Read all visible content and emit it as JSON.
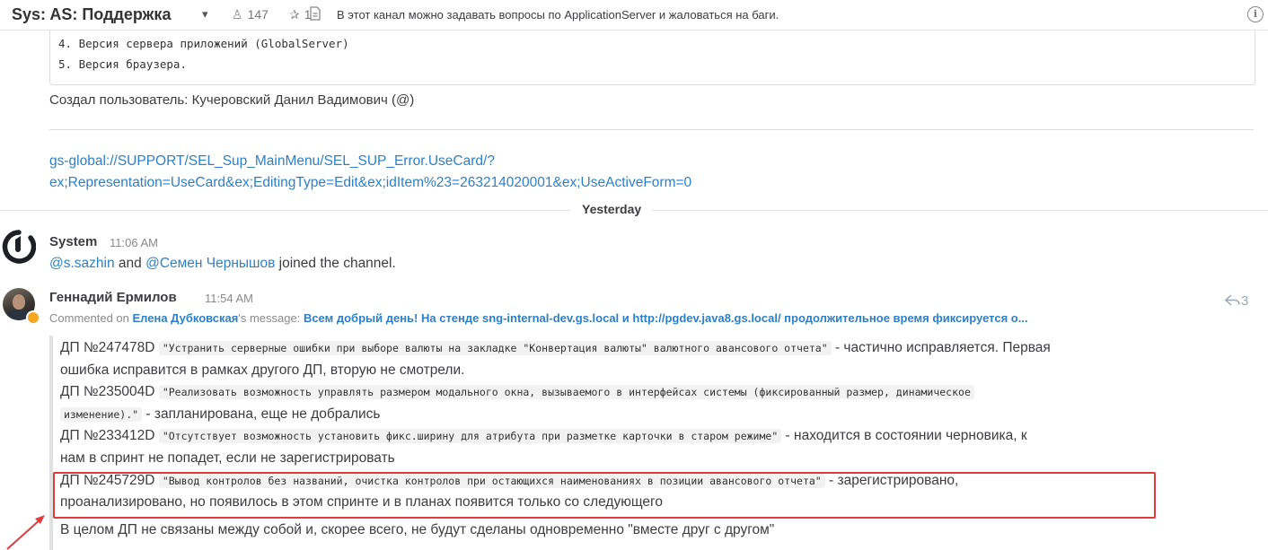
{
  "header": {
    "channel_name": "Sys: AS: Поддержка",
    "member_count": "147",
    "pinned_count": "1",
    "purpose": "В этот канал можно задавать вопросы по ApplicationServer и жаловаться на баги.",
    "info_icon_glyph": "i"
  },
  "earlier_post": {
    "code_lines": [
      "4. Версия сервера приложений (GlobalServer)",
      "5. Версия браузера."
    ],
    "created_by": "Создал пользователь: Кучеровский Данил Вадимович (@)",
    "link_line1": "gs-global://SUPPORT/SEL_Sup_MainMenu/SEL_SUP_Error.UseCard/?",
    "link_line2": "ex;Representation=UseCard&ex;EditingType=Edit&ex;idItem%23=263214020001&ex;UseActiveForm=0"
  },
  "date_separator": "Yesterday",
  "system_post": {
    "author": "System",
    "time": "11:06 AM",
    "mention1": "@s.sazhin",
    "and": " and ",
    "mention2": "@Семен Чернышов",
    "rest": " joined the channel."
  },
  "reply_post": {
    "author": "Геннадий Ермилов",
    "time": "11:54 AM",
    "reply_count": "3",
    "commented_prefix": "Commented on ",
    "commented_user": "Елена Дубковская",
    "commented_mid": "'s message: ",
    "commented_message": "Всем добрый день! На стенде sng-internal-dev.gs.local и http://pgdev.java8.gs.local/ продолжительное время фиксируется о...",
    "items": [
      {
        "id": "ДП №247478D",
        "code": "\"Устранить серверные ошибки при выборе валюты на закладке \"Конвертация валюты\" валютного авансового отчета\"",
        "desc_a": " - частично исправляется. Первая",
        "desc_b": "ошибка исправится в рамках другого ДП, вторую не смотрели."
      },
      {
        "id": "ДП №235004D",
        "code": "\"Реализовать возможность управлять размером модального окна, вызываемого в интерфейсах системы (фиксированный размер, динамическое",
        "code2": "изменение).\"",
        "desc_b": " - запланирована, еще не добрались"
      },
      {
        "id": "ДП №233412D",
        "code": "\"Отсутствует возможность установить фикс.ширину для атрибута при разметке карточки в старом режиме\"",
        "desc_a": " - находится в состоянии черновика, к",
        "desc_b": "нам в спринт не попадет, если не зарегистрировать"
      },
      {
        "id": "ДП №245729D",
        "code": "\"Вывод контролов без названий, очистка контролов при остающихся наименованиях в позиции авансового отчета\"",
        "desc_a": " - зарегистрировано,",
        "desc_b": "проанализировано, но появилось в этом спринте и в планах появится только со следующего"
      }
    ],
    "summary": "В целом ДП не связаны между собой и, скорее всего, не будут сделаны одновременно \"вместе друг с другом\""
  },
  "colors": {
    "link": "#2d80c8",
    "highlight_border": "#e03c3c",
    "status_away": "#f5a623"
  },
  "icons": [
    "chevron-down-icon",
    "members-icon",
    "pin-icon",
    "purpose-doc-icon",
    "info-icon",
    "system-logo-icon",
    "reply-arrow-icon",
    "annotation-arrow-icon"
  ]
}
